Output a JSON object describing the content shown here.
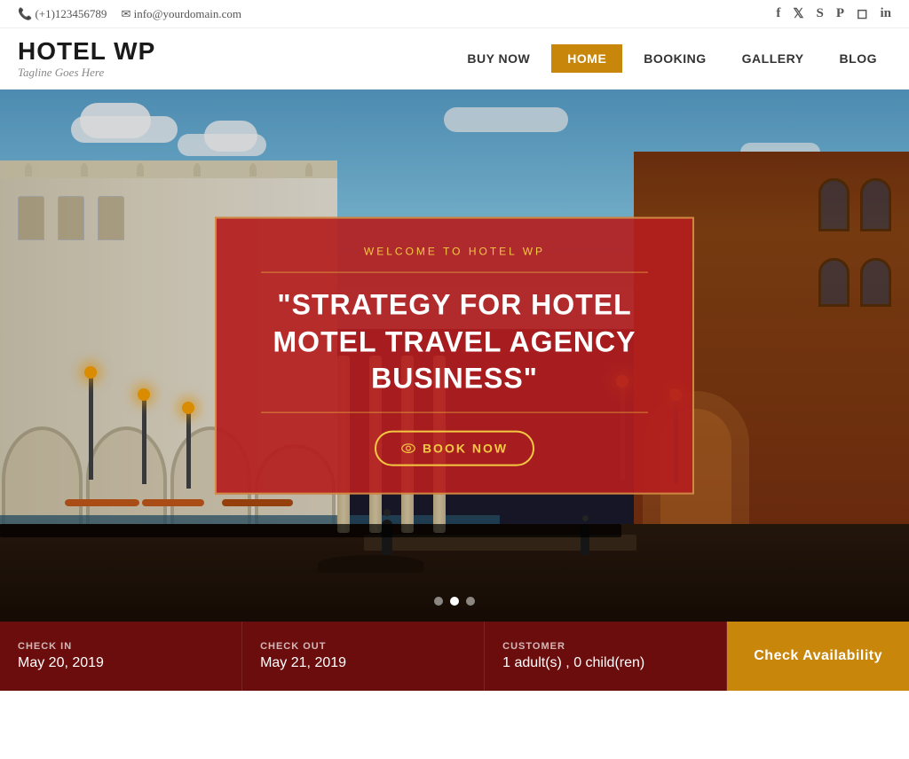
{
  "topbar": {
    "phone": "(+1)123456789",
    "email": "info@yourdomain.com",
    "social": {
      "facebook": "f",
      "twitter": "𝕏",
      "skype": "S",
      "pinterest": "P",
      "instagram": "◻",
      "linkedin": "in"
    }
  },
  "header": {
    "logo_title": "HOTEL WP",
    "logo_tagline": "Tagline Goes Here",
    "nav_items": [
      {
        "label": "BUY NOW",
        "active": false
      },
      {
        "label": "HOME",
        "active": true
      },
      {
        "label": "BOOKING",
        "active": false
      },
      {
        "label": "GALLERY",
        "active": false
      },
      {
        "label": "BLOG",
        "active": false
      }
    ]
  },
  "hero": {
    "subtitle": "WELCOME TO HOTEL WP",
    "title": "\"STRATEGY FOR HOTEL MOTEL TRAVEL AGENCY BUSINESS\"",
    "book_now_label": "BOOK NOW",
    "dots": [
      {
        "active": false
      },
      {
        "active": true
      },
      {
        "active": false
      }
    ]
  },
  "booking_bar": {
    "check_in_label": "CHECK IN",
    "check_in_value": "May 20, 2019",
    "check_out_label": "CHECK OUT",
    "check_out_value": "May 21, 2019",
    "customer_label": "CUSTOMER",
    "customer_value": "1 adult(s) , 0 child(ren)",
    "cta_label": "Check Availability"
  }
}
